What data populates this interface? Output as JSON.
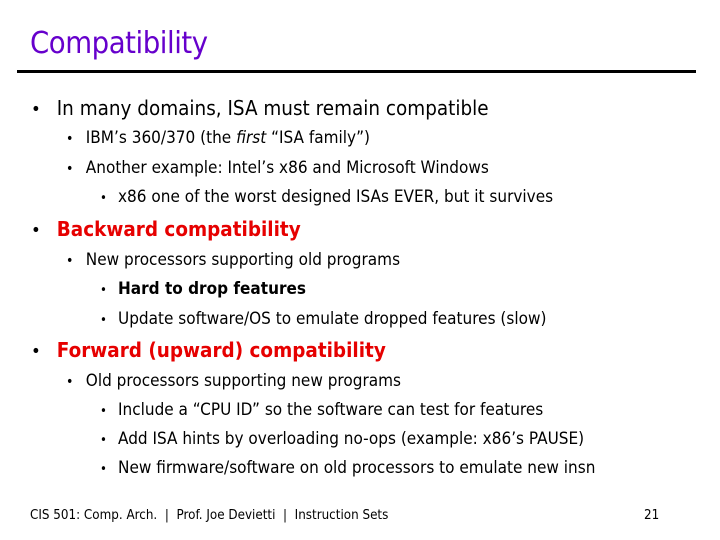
{
  "slide": {
    "title": "Compatibility",
    "bullet_char": "•",
    "items": [
      {
        "level": 1,
        "text": "In many domains, ISA must remain compatible"
      },
      {
        "level": 2,
        "text_before": "IBM’s 360/370 (the ",
        "italic": "first",
        "text_after": " “ISA family”)"
      },
      {
        "level": 2,
        "text": "Another example: Intel’s x86 and Microsoft Windows"
      },
      {
        "level": 3,
        "text": "x86 one of the worst designed ISAs EVER, but it survives"
      },
      {
        "level": 1,
        "text": "Backward compatibility",
        "style": "red-bold"
      },
      {
        "level": 2,
        "text": "New processors supporting old programs"
      },
      {
        "level": 3,
        "text": "Hard to drop features",
        "style": "bold"
      },
      {
        "level": 3,
        "text": "Update software/OS to emulate dropped features (slow)"
      },
      {
        "level": 1,
        "text": "Forward (upward) compatibility",
        "style": "red-bold"
      },
      {
        "level": 2,
        "text": "Old processors supporting new programs"
      },
      {
        "level": 3,
        "text": "Include a “CPU ID” so the software can test for features"
      },
      {
        "level": 3,
        "text": "Add ISA hints by overloading no-ops (example: x86’s PAUSE)"
      },
      {
        "level": 3,
        "text": "New firmware/software on old processors to emulate new insn"
      }
    ]
  },
  "footer": {
    "left": "CIS 501: Comp. Arch.  |  Prof. Joe Devietti  |  Instruction Sets",
    "page_number": "21"
  },
  "colors": {
    "title": "#6600cc",
    "heading": "#e60000",
    "text": "#000000"
  }
}
